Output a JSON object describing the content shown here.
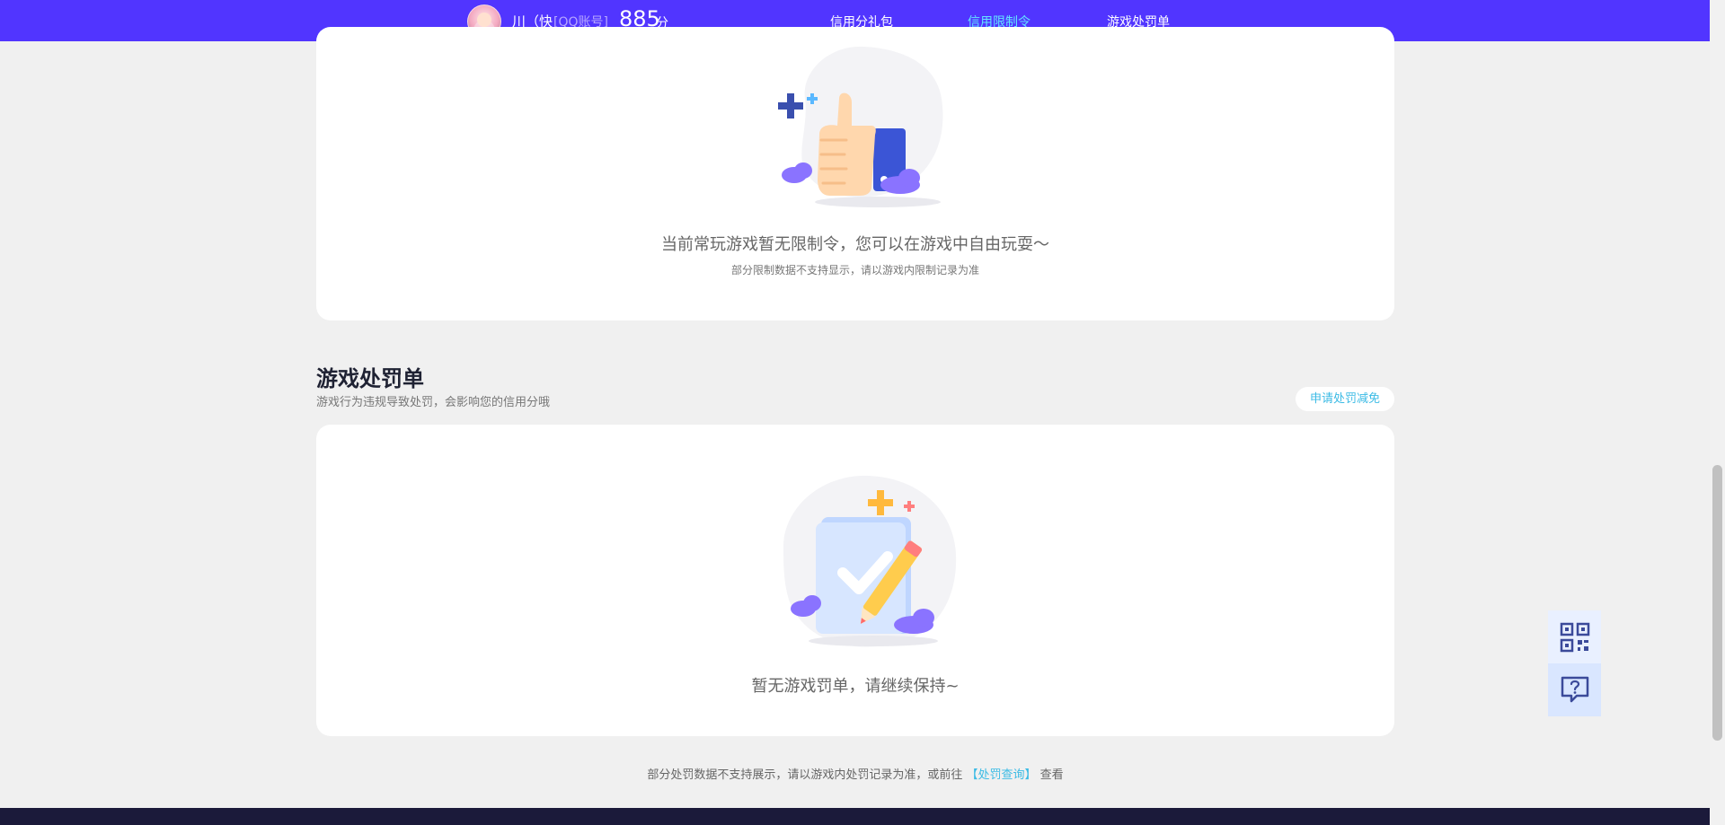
{
  "header": {
    "user_name": "川（快",
    "account_type": "[QQ账号]",
    "credit_score": "885",
    "credit_unit": "分",
    "tabs": [
      {
        "label": "信用分礼包",
        "active": false
      },
      {
        "label": "信用限制令",
        "active": true
      },
      {
        "label": "游戏处罚单",
        "active": false
      }
    ],
    "brand_color": "#5135ff",
    "active_color": "#63e4ff"
  },
  "restriction_card": {
    "message": "当前常玩游戏暂无限制令，您可以在游戏中自由玩耍～",
    "note": "部分限制数据不支持显示，请以游戏内限制记录为准",
    "illustration": "thumbs-up-illustration"
  },
  "penalty_section": {
    "title": "游戏处罚单",
    "subtitle": "游戏行为违规导致处罚，会影响您的信用分哦",
    "apply_button": "申请处罚减免",
    "empty_message": "暂无游戏罚单，请继续保持~",
    "illustration": "clipboard-check-illustration"
  },
  "footer": {
    "note_prefix": "部分处罚数据不支持展示，请以游戏内处罚记录为准，或前往",
    "link_text": "【处罚查询】",
    "note_suffix": "查看",
    "link_color": "#3bbbe5"
  },
  "tools": {
    "qr_icon": "qr-code-icon",
    "help_icon": "help-chat-icon"
  }
}
